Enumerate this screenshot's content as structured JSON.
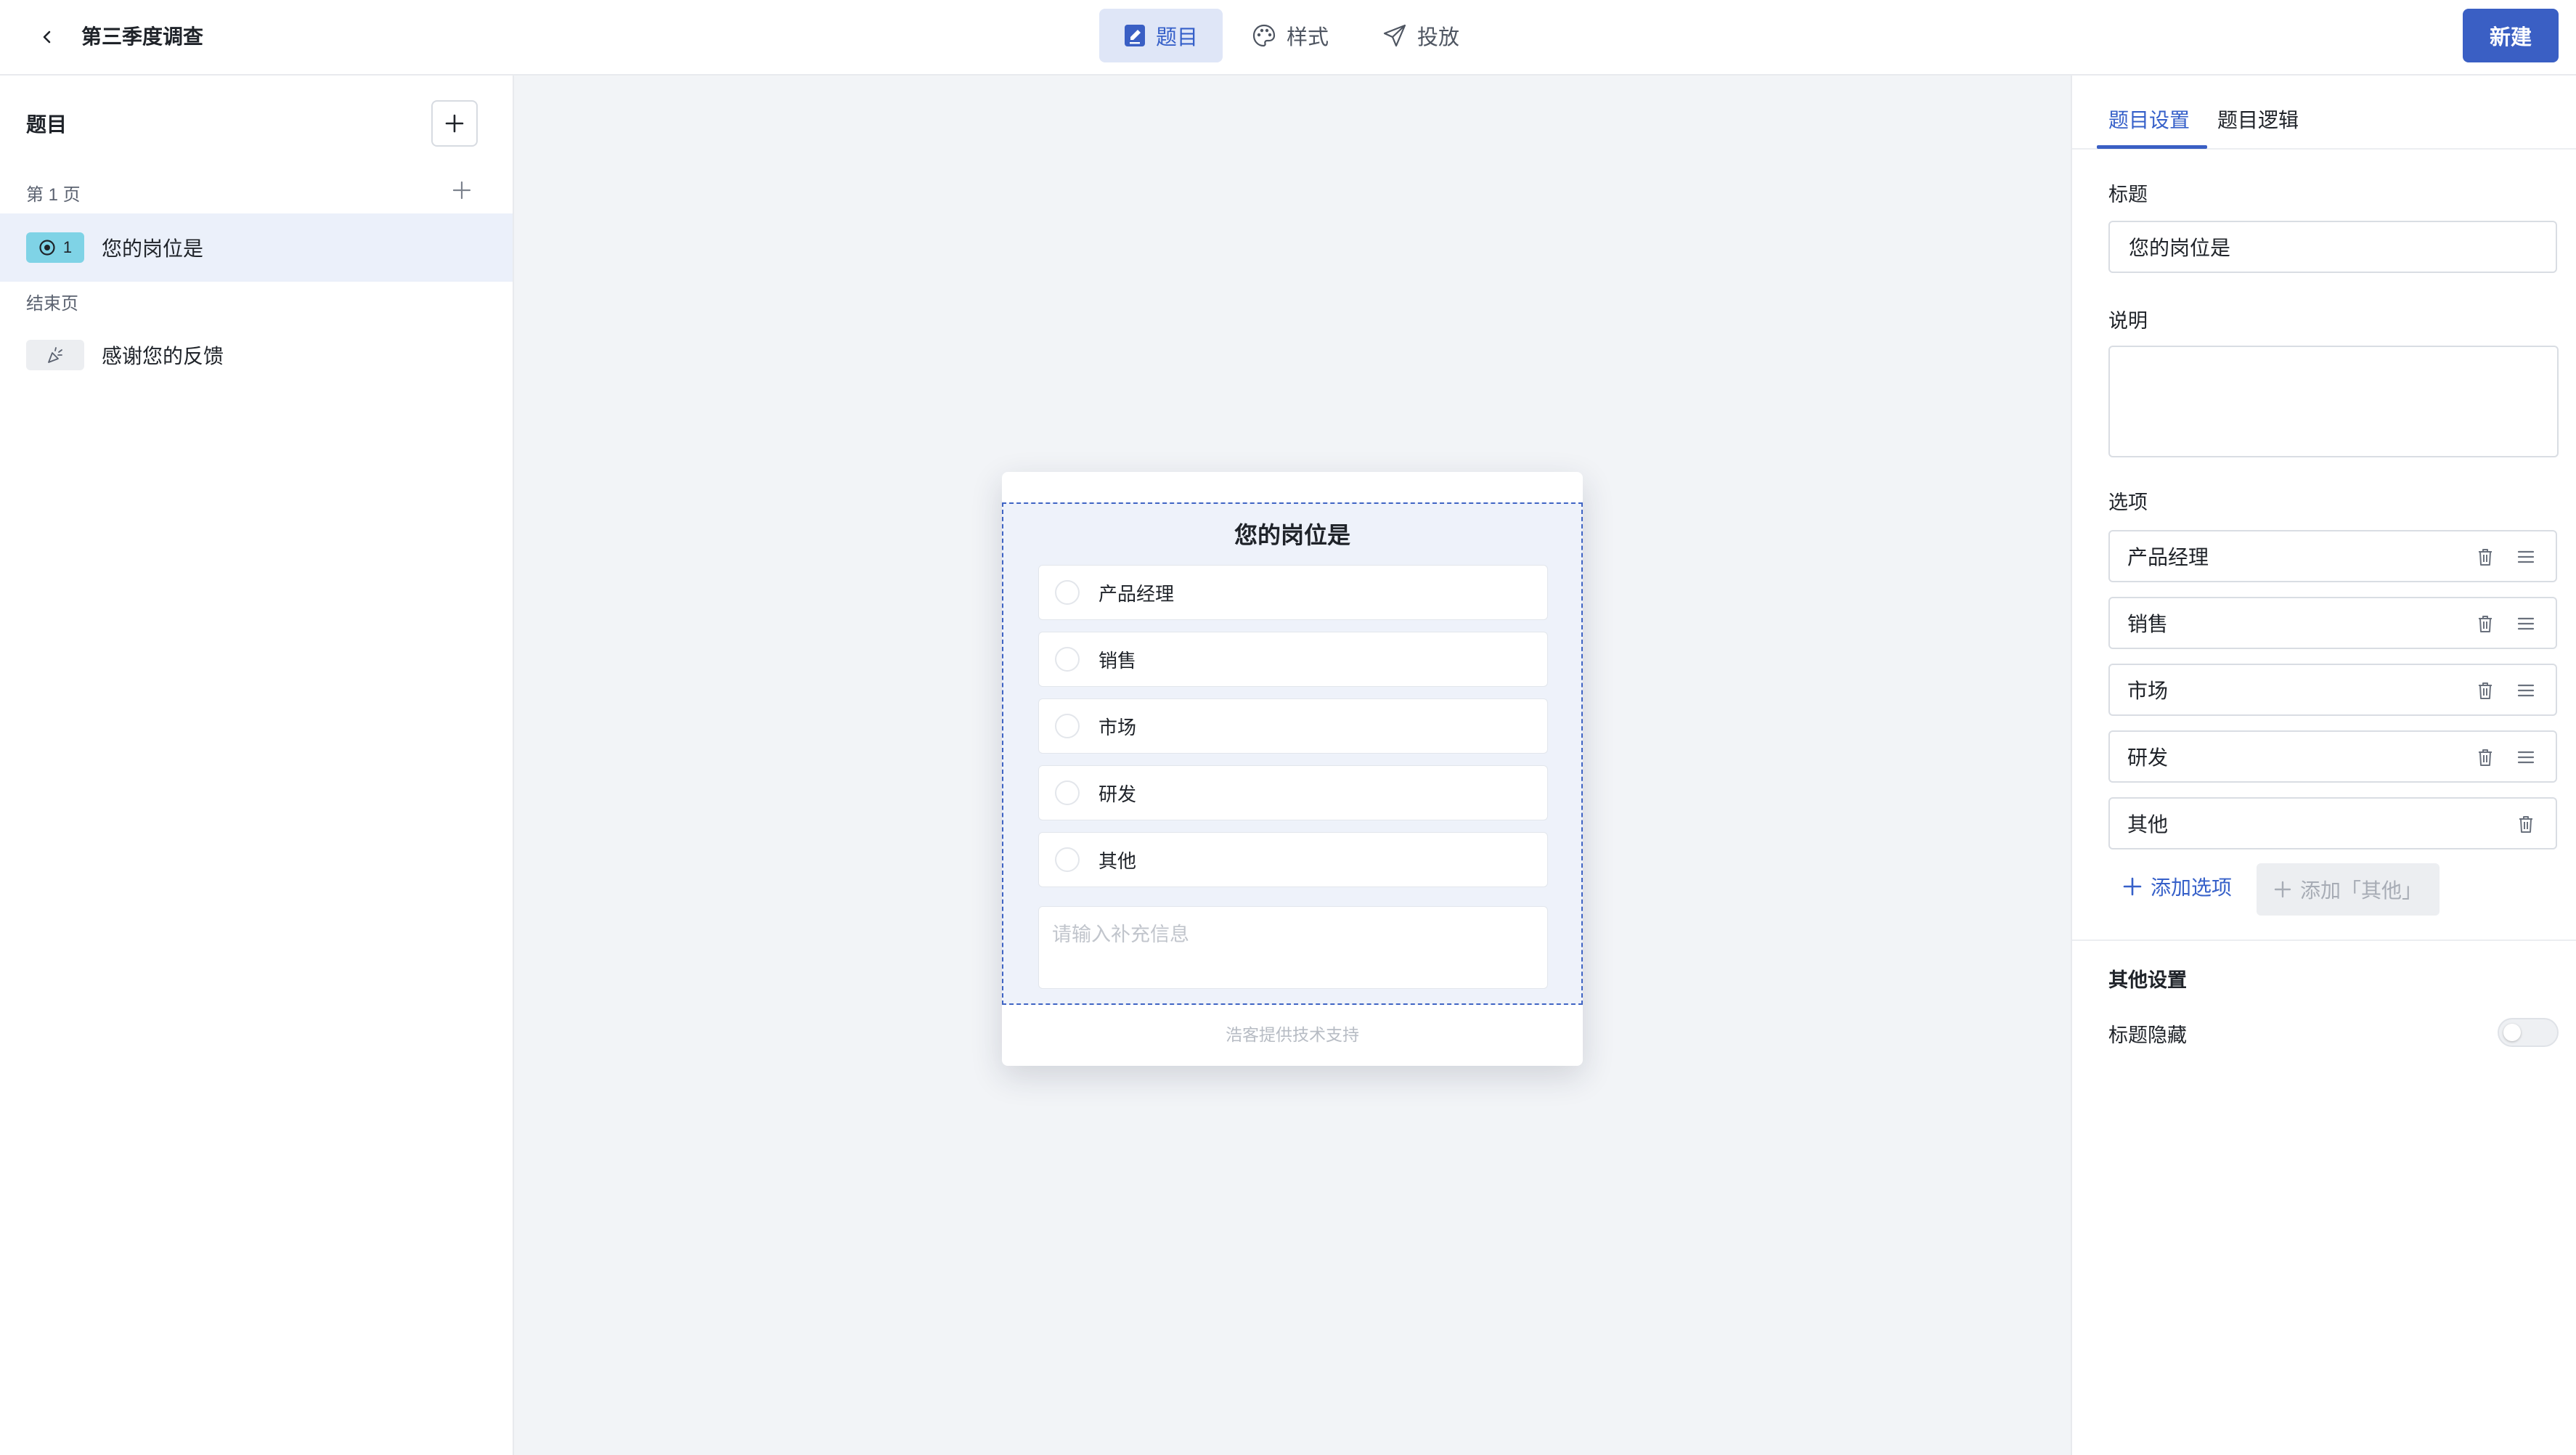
{
  "header": {
    "survey_title": "第三季度调查",
    "tabs": [
      {
        "label": "题目",
        "icon": "edit-document-icon",
        "active": true
      },
      {
        "label": "样式",
        "icon": "palette-icon",
        "active": false
      },
      {
        "label": "投放",
        "icon": "send-icon",
        "active": false
      }
    ],
    "new_button": "新建"
  },
  "sidebar": {
    "title": "题目",
    "page_label": "第 1 页",
    "questions": [
      {
        "number": "1",
        "text": "您的岗位是",
        "icon": "radio-icon",
        "selected": true
      }
    ],
    "end_page_label": "结束页",
    "end_items": [
      {
        "text": "感谢您的反馈",
        "icon": "party-popper-icon"
      }
    ]
  },
  "preview": {
    "question_title": "您的岗位是",
    "options": [
      "产品经理",
      "销售",
      "市场",
      "研发",
      "其他"
    ],
    "supplement_placeholder": "请输入补充信息",
    "powered_by": "浩客提供技术支持"
  },
  "settings": {
    "tabs": [
      "题目设置",
      "题目逻辑"
    ],
    "active_tab": 0,
    "title_label": "标题",
    "title_value": "您的岗位是",
    "description_label": "说明",
    "description_value": "",
    "options_label": "选项",
    "options": [
      "产品经理",
      "销售",
      "市场",
      "研发",
      "其他"
    ],
    "add_option": "添加选项",
    "add_other": "添加「其他」",
    "other_settings_label": "其他设置",
    "hide_title_label": "标题隐藏",
    "hide_title_enabled": false
  },
  "colors": {
    "primary": "#3a5fc4",
    "active_tab_bg": "#dfe6f7",
    "selected_row_bg": "#ebf0fa",
    "question_badge": "#7fd3e6",
    "canvas_bg": "#f2f4f7"
  }
}
